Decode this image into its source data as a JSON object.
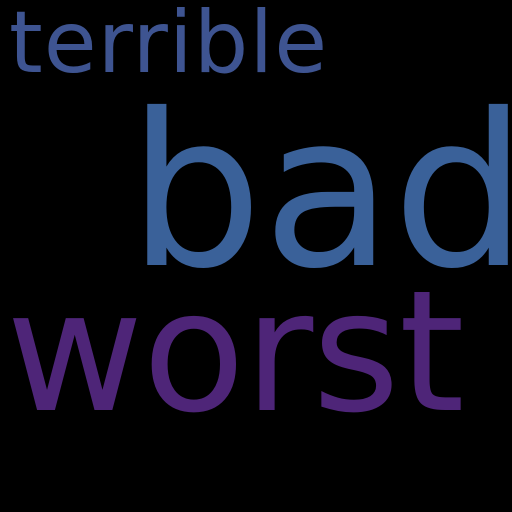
{
  "background_color": "#000000",
  "words": [
    {
      "text": "terrible",
      "color": "#3e5491"
    },
    {
      "text": "bad",
      "color": "#3a6199"
    },
    {
      "text": "worst",
      "color": "#4e2578"
    }
  ]
}
